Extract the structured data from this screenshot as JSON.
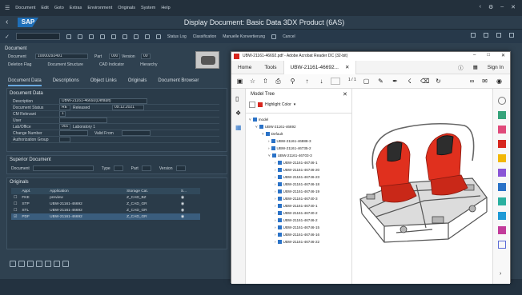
{
  "menubar": {
    "items": [
      "Document",
      "Edit",
      "Goto",
      "Extras",
      "Environment",
      "Originals",
      "System",
      "Help"
    ]
  },
  "title": "Display Document: Basic Data 3DX Product (6AS)",
  "sap_logo": "SAP",
  "toolbar": {
    "items": [
      "Status Log",
      "Classification",
      "Manuelle Konvertierung",
      "Cancel"
    ]
  },
  "document": {
    "section": "Document",
    "doc_label": "Document",
    "doc_value": "10000292491",
    "part_label": "Part",
    "part_value": "000",
    "version_label": "Version",
    "version_value": "00",
    "checks": [
      "Deletion Flag",
      "Document Structure",
      "CAD Indicator",
      "Hierarchy"
    ]
  },
  "tabs": [
    "Document Data",
    "Descriptions",
    "Object Links",
    "Originals",
    "Document Browser"
  ],
  "document_data": {
    "section": "Document Data",
    "rows": [
      {
        "label": "Description",
        "value": "UBW-21161-46692(Default)"
      },
      {
        "label": "Document Status",
        "value": "RE",
        "extra": "Released",
        "date": "09.12.2021"
      },
      {
        "label": "CM Relevant",
        "value": "1"
      },
      {
        "label": "User",
        "value": ""
      },
      {
        "label": "Lab/Office",
        "value": "001",
        "extra": "Laboratory 1"
      },
      {
        "label": "Change Number",
        "value": "",
        "extra": "Valid From"
      },
      {
        "label": "Authorization Group",
        "value": ""
      }
    ]
  },
  "superior": {
    "section": "Superior Document",
    "labels": [
      "Document",
      "Type",
      "Part",
      "Version"
    ]
  },
  "originals": {
    "section": "Originals",
    "columns": [
      "Appl.",
      "Application",
      "Storage Cat.",
      "S..."
    ],
    "rows": [
      {
        "appl": "FKE",
        "application": "preview",
        "storage": "Z_CAD_BZ"
      },
      {
        "appl": "STP",
        "application": "UBW-21161-46692",
        "storage": "Z_CAD_GR"
      },
      {
        "appl": "STL",
        "application": "UBW-21161-46692",
        "storage": "Z_CAD_GR"
      },
      {
        "appl": "PDF",
        "application": "UBW-21161-46692",
        "storage": "Z_CAD_GR"
      }
    ]
  },
  "acrobat": {
    "window_title": "UBW-21161-46692.pdf - Adobe Acrobat Reader DC (32-bit)",
    "tabs": [
      "Home",
      "Tools",
      "UBW-21161-46692..."
    ],
    "sign_in": "Sign In",
    "page": "1 / 1",
    "model_tree": {
      "title": "Model Tree",
      "highlight": "Highlight Color",
      "items": [
        {
          "level": 0,
          "label": "model"
        },
        {
          "level": 1,
          "label": "UBW-21161-46692"
        },
        {
          "level": 2,
          "label": "Default"
        },
        {
          "level": 3,
          "label": "UBW-21161-46888-3"
        },
        {
          "level": 3,
          "label": "UBW-21161-46735-2"
        },
        {
          "level": 3,
          "label": "UBW-21161-46703-3"
        },
        {
          "level": 4,
          "label": "UBW-21161-46746-1"
        },
        {
          "level": 4,
          "label": "UBW-21161-46746-20"
        },
        {
          "level": 4,
          "label": "UBW-21161-46746-23"
        },
        {
          "level": 4,
          "label": "UBW-21161-46746-18"
        },
        {
          "level": 4,
          "label": "UBW-21161-46746-19"
        },
        {
          "level": 4,
          "label": "UBW-21161-46740-3"
        },
        {
          "level": 4,
          "label": "UBW-21161-46740-1"
        },
        {
          "level": 4,
          "label": "UBW-21161-46740-2"
        },
        {
          "level": 4,
          "label": "UBW-21161-46746-2"
        },
        {
          "level": 4,
          "label": "UBW-21161-46746-15"
        },
        {
          "level": 4,
          "label": "UBW-21161-46746-16"
        },
        {
          "level": 4,
          "label": "UBW-21161-46746-22"
        }
      ]
    }
  },
  "colors": {
    "sap_bg": "#2f4150",
    "accent": "#6aa9e0",
    "acrobat_red": "#d7261e",
    "seat_red": "#e0301e"
  }
}
